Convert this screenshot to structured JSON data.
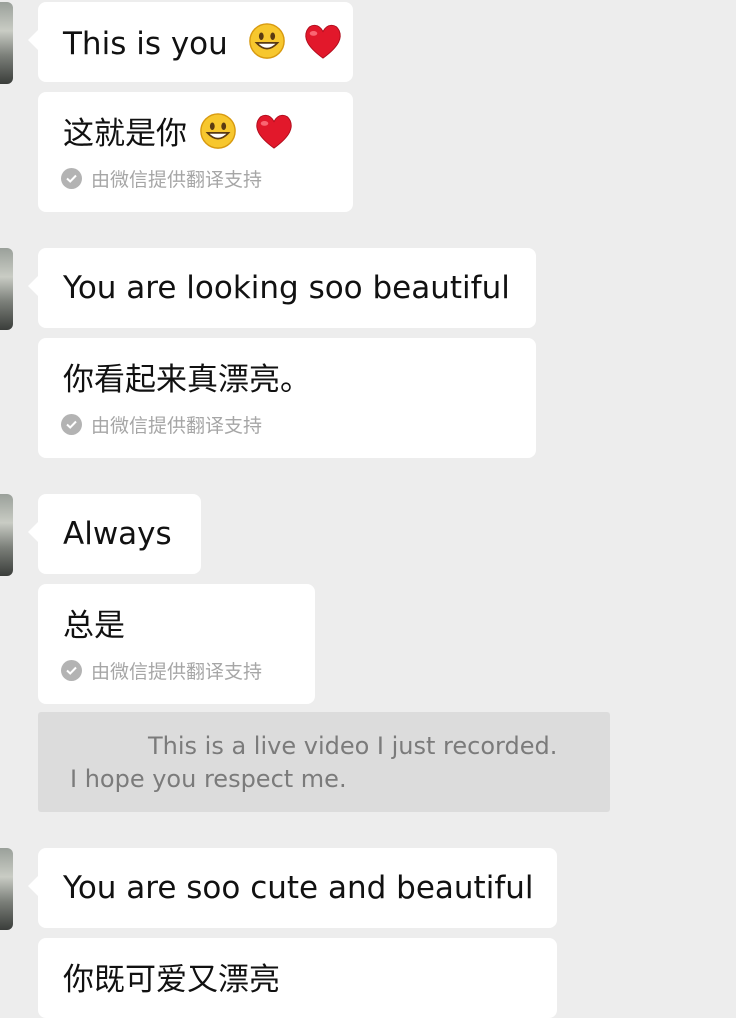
{
  "messages": [
    {
      "text": "This is you",
      "emoji": [
        "smiley-icon",
        "red-heart-icon"
      ],
      "translation": "这就是你",
      "credit": "由微信提供翻译支持"
    },
    {
      "text": "You are looking soo beautiful",
      "translation": "你看起来真漂亮。",
      "credit": "由微信提供翻译支持"
    },
    {
      "text": "Always",
      "translation": "总是",
      "credit": "由微信提供翻译支持"
    },
    {
      "text": "You are soo cute and beautiful",
      "translation": "你既可爱又漂亮"
    }
  ],
  "system_notice": {
    "line1": "This is a live video I just recorded.",
    "line2": "I hope you respect me."
  },
  "colors": {
    "background": "#ededed",
    "bubble": "#ffffff",
    "system_box": "#dcdcdc",
    "credit_text": "#a6a6a6"
  }
}
